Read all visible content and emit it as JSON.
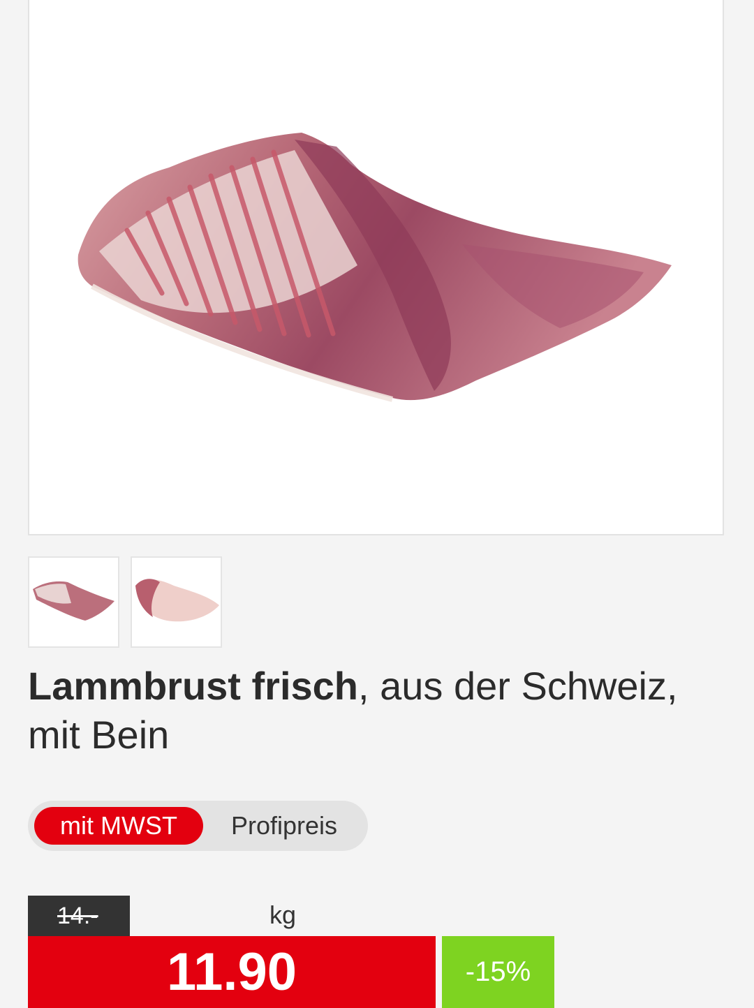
{
  "product": {
    "image_alt": "Lammbrust frisch",
    "thumbnails": [
      "lamb-breast-outer",
      "lamb-breast-inner"
    ],
    "title_bold": "Lammbrust frisch",
    "title_rest": ", aus der Schweiz, mit Bein"
  },
  "price_mode": {
    "options": [
      "mit MWST",
      "Profipreis"
    ],
    "selected": "mit MWST"
  },
  "pricing": {
    "old_price": "14.-",
    "unit": "kg",
    "current_price": "11.90",
    "discount": "-15%",
    "colors": {
      "price_red": "#e3000f",
      "discount_green": "#7ed321",
      "old_price_bg": "#333333"
    }
  }
}
